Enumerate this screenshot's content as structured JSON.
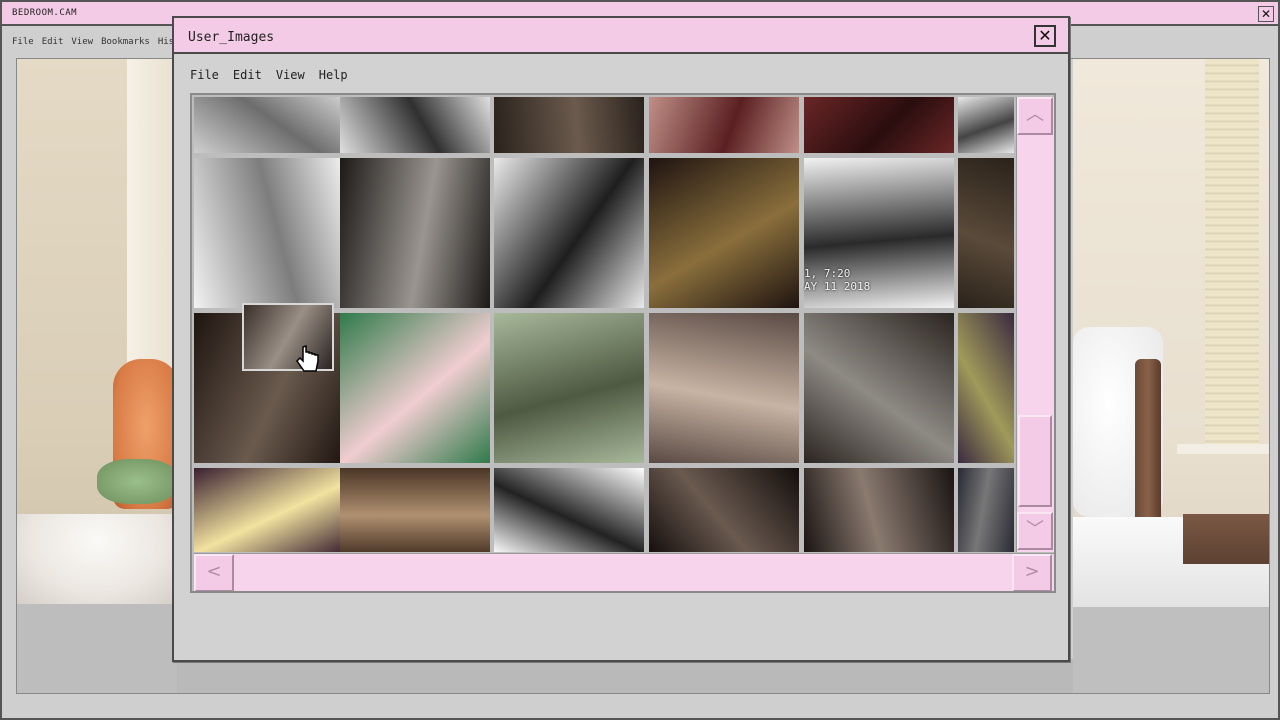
{
  "browser": {
    "title": "BEDROOM.CAM",
    "menu": [
      "File",
      "Edit",
      "View",
      "Bookmarks",
      "History"
    ],
    "close_glyph": "✕"
  },
  "window": {
    "title": "User_Images",
    "close_glyph": "✕",
    "menu": [
      "File",
      "Edit",
      "View",
      "Help"
    ]
  },
  "grid": {
    "rows": [
      [
        "#cfcfcf-#6d6d6d",
        "#e0e0e0-#303030",
        "#2a221c-#6b5a4d",
        "#c08f86-#5a1f22",
        "#6a2627-#2a0d0e",
        "#e8e8e8-#444"
      ],
      [
        "#f2f2f2-#7d7d7d",
        "#1c1917-#9a9590",
        "#eaeaea-#1e1e1e",
        "#1e1310-#8a6f3c",
        "#f2f2f2-#2a2a2a",
        "#2a221a-#5a4a3a"
      ],
      [
        "#1e1510-#6a5a4e",
        "#2f7a4a-#f0cdd0",
        "#a8b89a-#4e5a42",
        "#5a4a44-#c8b4a4",
        "#2b2420-#8e8a84",
        "#3a2a40-#a09a5a"
      ],
      [
        "#3a2030-#f2e3a0",
        "#4a3526-#b09070",
        "#ffffff-#222222",
        "#140e0c-#6a5a50",
        "#1a1412-#8a7a70",
        "#2a2a35-#777"
      ]
    ],
    "stamp_time": "1, 7:20",
    "stamp_date": "AY 11 2018"
  },
  "scroll": {
    "up_glyph": "︿",
    "down_glyph": "﹀",
    "left_glyph": "<",
    "right_glyph": ">"
  }
}
